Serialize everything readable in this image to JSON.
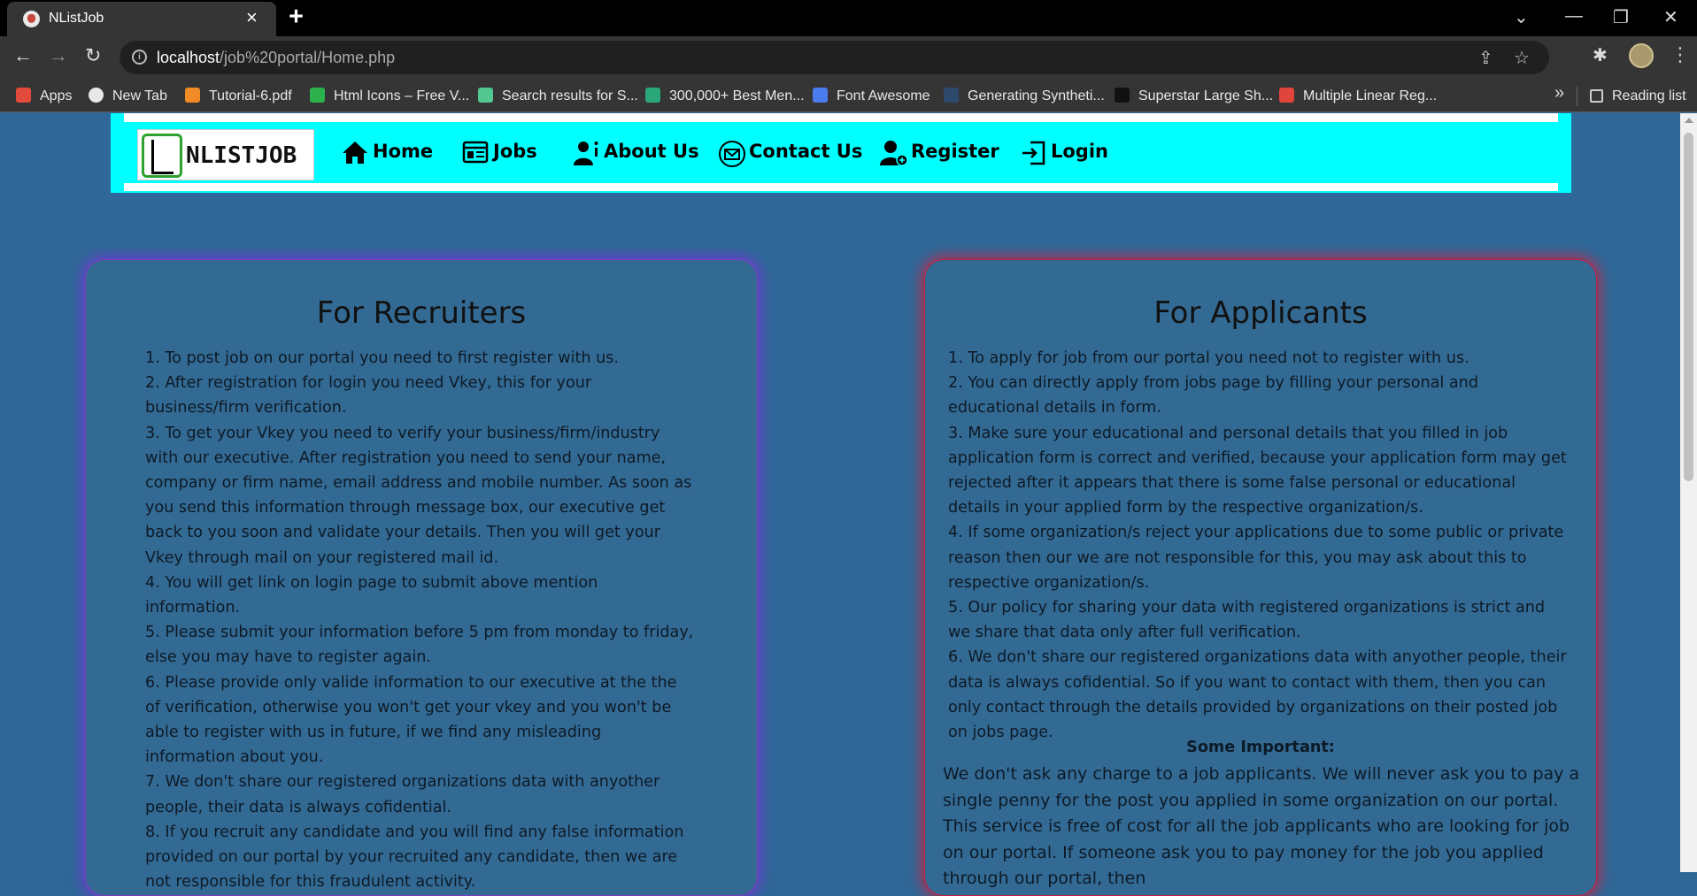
{
  "browser": {
    "tab_title": "NListJob",
    "url_host": "localhost",
    "url_path": "/job%20portal/Home.php",
    "reading_list": "Reading list",
    "bookmarks": [
      {
        "label": "Apps",
        "icon": "apps-grid-icon",
        "color": "#e24a3b"
      },
      {
        "label": "New Tab",
        "icon": "globe-icon",
        "color": "#e8e8e8"
      },
      {
        "label": "Tutorial-6.pdf",
        "icon": "pdf-icon",
        "color": "#f08a24"
      },
      {
        "label": "Html Icons – Free V...",
        "icon": "html-icons-icon",
        "color": "#2bb24c"
      },
      {
        "label": "Search results for S...",
        "icon": "vector-icon",
        "color": "#52c78f"
      },
      {
        "label": "300,000+ Best Men...",
        "icon": "freepik-icon",
        "color": "#2aa879"
      },
      {
        "label": "Font Awesome",
        "icon": "flag-icon",
        "color": "#4b7bec"
      },
      {
        "label": "Generating Syntheti...",
        "icon": "tds-icon",
        "color": "#2d4a6e"
      },
      {
        "label": "Superstar Large Sh...",
        "icon": "tiktok-icon",
        "color": "#111111"
      },
      {
        "label": "Multiple Linear Reg...",
        "icon": "sa-icon",
        "color": "#e0443b"
      }
    ]
  },
  "site": {
    "logo_text": "NLISTJOB",
    "nav": [
      {
        "label": "Home",
        "icon": "home-icon"
      },
      {
        "label": "Jobs",
        "icon": "jobs-icon"
      },
      {
        "label": "About Us",
        "icon": "about-user-icon"
      },
      {
        "label": "Contact Us",
        "icon": "contact-mail-icon"
      },
      {
        "label": "Register",
        "icon": "register-user-icon"
      },
      {
        "label": "Login",
        "icon": "login-icon"
      }
    ]
  },
  "recruiters": {
    "title": "For Recruiters",
    "items": [
      "1. To post job on our portal you need to first register with us.",
      "2. After registration for login you need Vkey, this for your business/firm verification.",
      "3. To get your Vkey you need to verify your business/firm/industry with our executive. After registration you need to send your name, company or firm name, email address and mobile number. As soon as you send this information through message box, our executive get back to you soon and validate your details. Then you will get your Vkey through mail on your registered mail id.",
      "4. You will get link on login page to submit above mention information.",
      "5. Please submit your information before 5 pm from monday to friday, else you may have to register again.",
      "6. Please provide only valide information to our executive at the the of verification, otherwise you won't get your vkey and you won't be able to register with us in future, if we find any misleading information about you.",
      "7. We don't share our registered organizations data with anyother people, their data is always cofidential.",
      "8. If you recruit any candidate and you will find any false information provided on our portal by your recruited any candidate, then we are not responsible for this fraudulent activity."
    ]
  },
  "applicants": {
    "title": "For Applicants",
    "items": [
      "1. To apply for job from our portal you need not to register with us.",
      "2. You can directly apply from jobs page by filling your personal and educational details in form.",
      "3. Make sure your educational and personal details that you filled in job application form is correct and verified, because your application form may get rejected after it appears that there is some false personal or educational details in your applied form by the respective organization/s.",
      "4. If some organization/s reject your applications due to some public or private reason then our we are not responsible for this, you may ask about this to respective organization/s.",
      "5. Our policy for sharing your data with registered organizations is strict and we share that data only after full verification.",
      "6. We don't share our registered organizations data with anyother people, their data is always cofidential. So if you want to contact with them, then you can only contact through the details provided by organizations on their posted job on jobs page."
    ],
    "important_title": "Some Important:",
    "important_text": "We don't ask any charge to a job applicants. We will never ask you to pay a single penny for the post you applied in some organization on our portal. This service is free of cost for all the job applicants who are looking for job on our portal. If someone ask you to pay money for the job you applied through our portal, then"
  }
}
